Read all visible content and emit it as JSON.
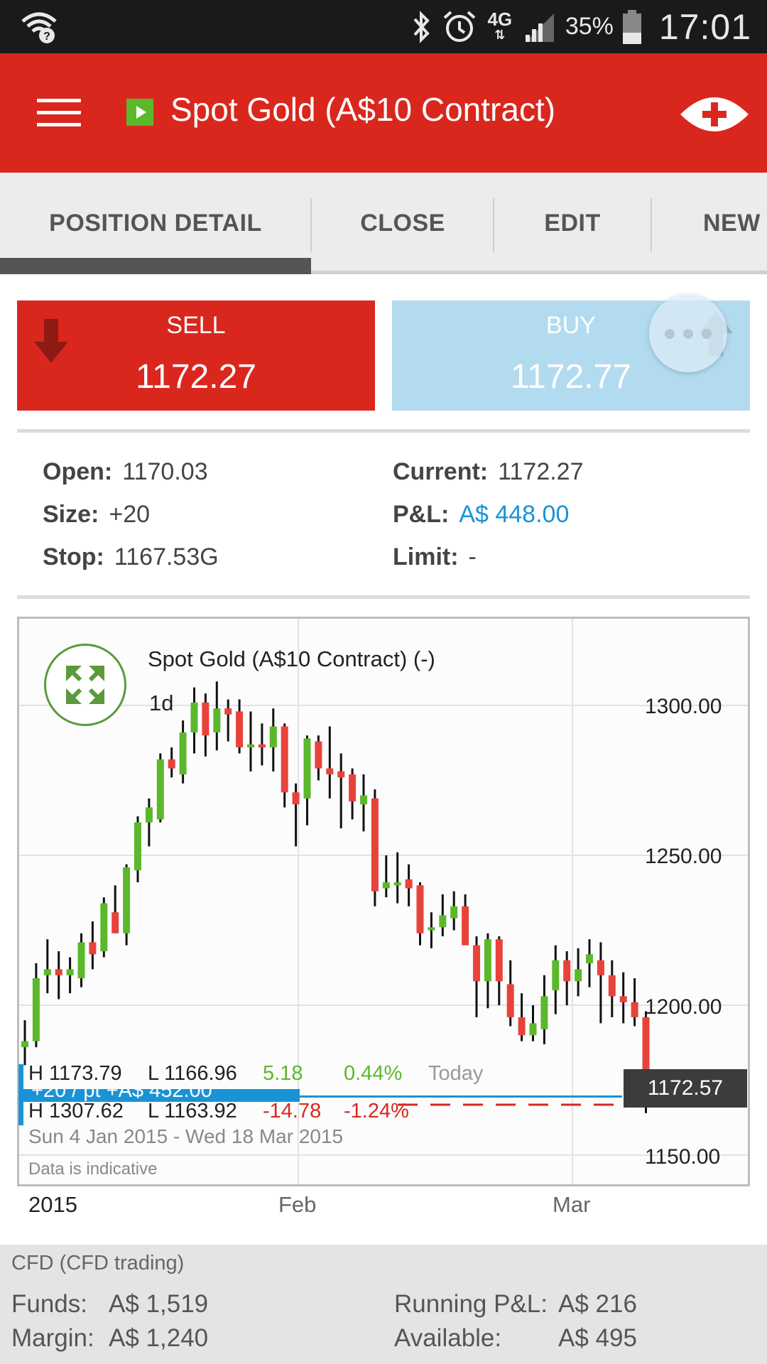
{
  "status_bar": {
    "battery_pct": "35%",
    "time": "17:01",
    "network": "4G",
    "icons": [
      "wifi-question-icon",
      "bluetooth-icon",
      "alarm-icon",
      "signal-icon",
      "battery-icon"
    ]
  },
  "app_bar": {
    "title": "Spot Gold (A$10 Contract)",
    "icons": [
      "menu-icon",
      "market-play-icon",
      "eye-icon"
    ]
  },
  "tabs": [
    {
      "label": "POSITION DETAIL",
      "active": true
    },
    {
      "label": "CLOSE",
      "active": false
    },
    {
      "label": "EDIT",
      "active": false
    },
    {
      "label": "NEW T",
      "active": false
    }
  ],
  "prices": {
    "sell": {
      "label": "SELL",
      "price": "1172.27"
    },
    "buy": {
      "label": "BUY",
      "price": "1172.77"
    }
  },
  "position": {
    "open_label": "Open:",
    "open_value": "1170.03",
    "size_label": "Size:",
    "size_value": "+20",
    "stop_label": "Stop:",
    "stop_value": "1167.53G",
    "current_label": "Current:",
    "current_value": "1172.27",
    "pnl_label": "P&L:",
    "pnl_value": "A$ 448.00",
    "limit_label": "Limit:",
    "limit_value": "-"
  },
  "chart": {
    "title": "Spot Gold (A$10 Contract) (-)",
    "interval": "1d",
    "current_price_tag": "1172.57",
    "position_label": "+20 / pt   +A$ 452.00",
    "today_stats": {
      "high": "H 1173.79",
      "low": "L 1166.96",
      "change": "5.18",
      "change_pct": "0.44%",
      "period": "Today"
    },
    "range_stats": {
      "high": "H 1307.62",
      "low": "L 1163.92",
      "change": "-14.78",
      "change_pct": "-1.24%"
    },
    "date_range": "Sun 4 Jan 2015 - Wed 18 Mar 2015",
    "disclaimer": "Data is indicative",
    "colors": {
      "up": "#5cb82b",
      "down": "#e8433a",
      "position": "#1a93d6",
      "stop_line": "#d9271e"
    }
  },
  "chart_data": {
    "type": "candlestick",
    "title": "Spot Gold (A$10 Contract) (-)",
    "x_tick_labels": [
      "2015",
      "Feb",
      "Mar"
    ],
    "y_tick_labels": [
      "1300.00",
      "1250.00",
      "1200.00",
      "1150.00"
    ],
    "ylim": [
      1142,
      1320
    ],
    "grid": true,
    "candles": [
      {
        "o": 1186,
        "h": 1195,
        "l": 1180,
        "c": 1188
      },
      {
        "o": 1188,
        "h": 1214,
        "l": 1186,
        "c": 1209
      },
      {
        "o": 1210,
        "h": 1222,
        "l": 1204,
        "c": 1212
      },
      {
        "o": 1212,
        "h": 1218,
        "l": 1202,
        "c": 1210
      },
      {
        "o": 1210,
        "h": 1216,
        "l": 1204,
        "c": 1212
      },
      {
        "o": 1209,
        "h": 1224,
        "l": 1206,
        "c": 1221
      },
      {
        "o": 1221,
        "h": 1228,
        "l": 1212,
        "c": 1217
      },
      {
        "o": 1218,
        "h": 1236,
        "l": 1216,
        "c": 1234
      },
      {
        "o": 1231,
        "h": 1240,
        "l": 1224,
        "c": 1224
      },
      {
        "o": 1224,
        "h": 1247,
        "l": 1220,
        "c": 1246
      },
      {
        "o": 1245,
        "h": 1263,
        "l": 1241,
        "c": 1261
      },
      {
        "o": 1261,
        "h": 1269,
        "l": 1253,
        "c": 1266
      },
      {
        "o": 1262,
        "h": 1284,
        "l": 1261,
        "c": 1282
      },
      {
        "o": 1282,
        "h": 1286,
        "l": 1276,
        "c": 1279
      },
      {
        "o": 1277,
        "h": 1295,
        "l": 1274,
        "c": 1291
      },
      {
        "o": 1291,
        "h": 1306,
        "l": 1284,
        "c": 1301
      },
      {
        "o": 1301,
        "h": 1304,
        "l": 1283,
        "c": 1290
      },
      {
        "o": 1291,
        "h": 1308,
        "l": 1285,
        "c": 1299
      },
      {
        "o": 1299,
        "h": 1302,
        "l": 1288,
        "c": 1297
      },
      {
        "o": 1298,
        "h": 1302,
        "l": 1284,
        "c": 1286
      },
      {
        "o": 1286,
        "h": 1298,
        "l": 1278,
        "c": 1287
      },
      {
        "o": 1287,
        "h": 1294,
        "l": 1280,
        "c": 1286
      },
      {
        "o": 1286,
        "h": 1299,
        "l": 1278,
        "c": 1293
      },
      {
        "o": 1293,
        "h": 1294,
        "l": 1266,
        "c": 1271
      },
      {
        "o": 1271,
        "h": 1274,
        "l": 1253,
        "c": 1267
      },
      {
        "o": 1269,
        "h": 1290,
        "l": 1260,
        "c": 1289
      },
      {
        "o": 1288,
        "h": 1290,
        "l": 1275,
        "c": 1279
      },
      {
        "o": 1279,
        "h": 1293,
        "l": 1269,
        "c": 1277
      },
      {
        "o": 1278,
        "h": 1284,
        "l": 1259,
        "c": 1276
      },
      {
        "o": 1277,
        "h": 1279,
        "l": 1262,
        "c": 1268
      },
      {
        "o": 1267,
        "h": 1277,
        "l": 1258,
        "c": 1270
      },
      {
        "o": 1269,
        "h": 1272,
        "l": 1233,
        "c": 1238
      },
      {
        "o": 1239,
        "h": 1250,
        "l": 1236,
        "c": 1241
      },
      {
        "o": 1240,
        "h": 1251,
        "l": 1234,
        "c": 1241
      },
      {
        "o": 1242,
        "h": 1247,
        "l": 1233,
        "c": 1239
      },
      {
        "o": 1240,
        "h": 1241,
        "l": 1220,
        "c": 1224
      },
      {
        "o": 1225,
        "h": 1231,
        "l": 1219,
        "c": 1226
      },
      {
        "o": 1226,
        "h": 1237,
        "l": 1223,
        "c": 1230
      },
      {
        "o": 1229,
        "h": 1238,
        "l": 1225,
        "c": 1233
      },
      {
        "o": 1233,
        "h": 1237,
        "l": 1221,
        "c": 1220
      },
      {
        "o": 1220,
        "h": 1223,
        "l": 1196,
        "c": 1208
      },
      {
        "o": 1208,
        "h": 1224,
        "l": 1199,
        "c": 1222
      },
      {
        "o": 1222,
        "h": 1223,
        "l": 1200,
        "c": 1208
      },
      {
        "o": 1207,
        "h": 1215,
        "l": 1193,
        "c": 1196
      },
      {
        "o": 1196,
        "h": 1204,
        "l": 1188,
        "c": 1190
      },
      {
        "o": 1190,
        "h": 1200,
        "l": 1188,
        "c": 1194
      },
      {
        "o": 1192,
        "h": 1210,
        "l": 1187,
        "c": 1203
      },
      {
        "o": 1205,
        "h": 1220,
        "l": 1197,
        "c": 1215
      },
      {
        "o": 1215,
        "h": 1218,
        "l": 1200,
        "c": 1208
      },
      {
        "o": 1208,
        "h": 1219,
        "l": 1203,
        "c": 1212
      },
      {
        "o": 1214,
        "h": 1222,
        "l": 1206,
        "c": 1217
      },
      {
        "o": 1215,
        "h": 1221,
        "l": 1194,
        "c": 1210
      },
      {
        "o": 1210,
        "h": 1215,
        "l": 1196,
        "c": 1203
      },
      {
        "o": 1203,
        "h": 1211,
        "l": 1194,
        "c": 1201
      },
      {
        "o": 1201,
        "h": 1209,
        "l": 1193,
        "c": 1196
      },
      {
        "o": 1196,
        "h": 1198,
        "l": 1164,
        "c": 1172
      }
    ],
    "last_price": 1172.57,
    "position_open": 1170.03,
    "stop_level": 1167.53
  },
  "footer": {
    "title": "CFD (CFD trading)",
    "funds_label": "Funds:",
    "funds_value": "A$ 1,519",
    "margin_label": "Margin:",
    "margin_value": "A$ 1,240",
    "running_pnl_label": "Running P&L:",
    "running_pnl_value": "A$ 216",
    "available_label": "Available:",
    "available_value": "A$ 495"
  }
}
